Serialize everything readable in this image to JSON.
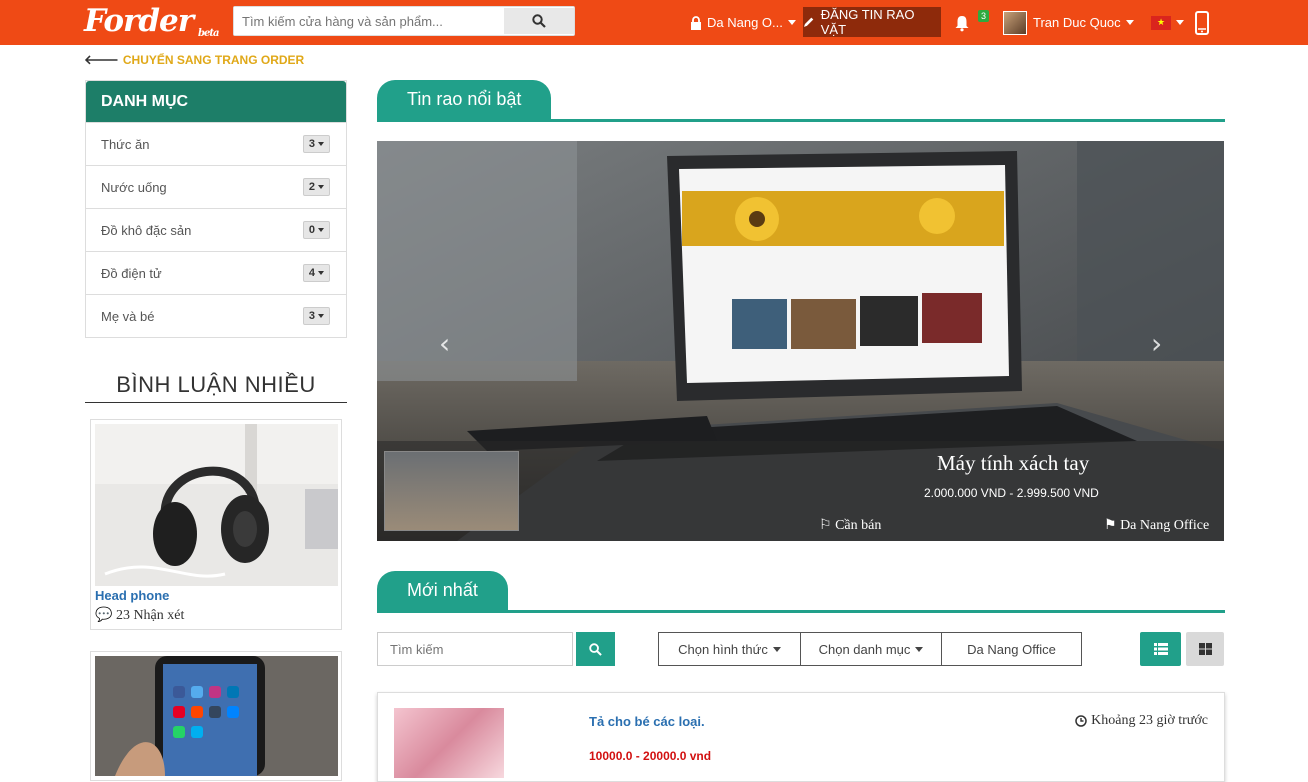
{
  "navbar": {
    "logo": "Forder",
    "logo_tag": "beta",
    "search_placeholder": "Tìm kiếm cửa hàng và sản phẩm...",
    "location": "Da Nang O...",
    "post_label": "ĐĂNG TIN RAO VẶT",
    "notification_count": "3",
    "user_name": "Tran Duc Quoc"
  },
  "back_link": "CHUYỂN SANG TRANG ORDER",
  "categories": {
    "title": "DANH MỤC",
    "items": [
      {
        "label": "Thức ăn",
        "count": "3"
      },
      {
        "label": "Nước uống",
        "count": "2"
      },
      {
        "label": "Đồ khô đặc sản",
        "count": "0"
      },
      {
        "label": "Đồ điện tử",
        "count": "4"
      },
      {
        "label": "Mẹ và bé",
        "count": "3"
      }
    ]
  },
  "most_commented": {
    "title": "BÌNH LUẬN NHIỀU",
    "cards": [
      {
        "title": "Head phone",
        "comments": "23 Nhận xét"
      }
    ]
  },
  "featured": {
    "title": "Tin rao nổi bật",
    "slide": {
      "title": "Máy tính xách tay",
      "price": "2.000.000 VND - 2.999.500 VND",
      "type": "Cần bán",
      "location": "Da Nang Office"
    }
  },
  "latest": {
    "title": "Mới nhất",
    "search_placeholder": "Tìm kiếm",
    "filter_type": "Chọn hình thức",
    "filter_category": "Chọn danh mục",
    "filter_location": "Da Nang Office",
    "listing": {
      "title": "Tả cho bé các loại.",
      "price": "10000.0 - 20000.0 vnd",
      "time": "Khoảng 23 giờ trước"
    }
  },
  "colors": {
    "brand_orange": "#ef4a15",
    "teal": "#21a08a",
    "dark_teal": "#1d7e68",
    "gold": "#e0a818"
  }
}
